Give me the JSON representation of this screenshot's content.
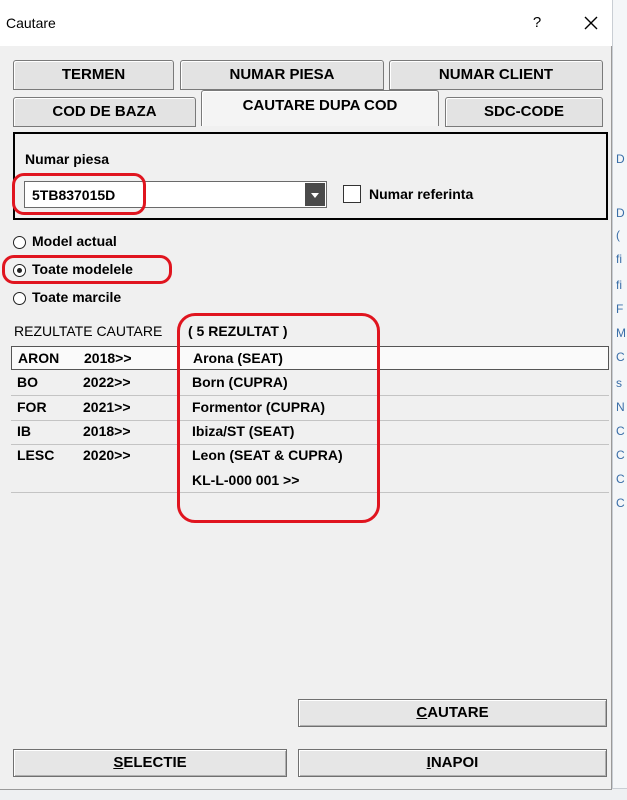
{
  "window": {
    "title": "Cautare",
    "help_label": "?"
  },
  "tabs": {
    "row1": [
      "TERMEN",
      "NUMAR PIESA",
      "NUMAR CLIENT"
    ],
    "row2": [
      "COD DE BAZA",
      "CAUTARE DUPA COD",
      "SDC-CODE"
    ],
    "active": "CAUTARE DUPA COD"
  },
  "search": {
    "label": "Numar piesa",
    "value": "5TB837015D",
    "reference_checkbox_label": "Numar referinta",
    "reference_checked": false
  },
  "scope": {
    "options": [
      "Model actual",
      "Toate modelele",
      "Toate marcile"
    ],
    "selected": "Toate modelele"
  },
  "results": {
    "header": "REZULTATE CAUTARE",
    "count_label": "( 5  REZULTAT )",
    "rows": [
      {
        "code": "ARON",
        "year": "2018>>",
        "name": "Arona (SEAT)"
      },
      {
        "code": "BO",
        "year": "2022>>",
        "name": "Born (CUPRA)"
      },
      {
        "code": "FOR",
        "year": "2021>>",
        "name": "Formentor (CUPRA)"
      },
      {
        "code": "IB",
        "year": "2018>>",
        "name": "Ibiza/ST (SEAT)"
      },
      {
        "code": "LESC",
        "year": "2020>>",
        "name": "Leon (SEAT & CUPRA)"
      }
    ],
    "extra_line": "KL-L-000 001 >>"
  },
  "buttons": {
    "search": {
      "first": "C",
      "rest": "AUTARE"
    },
    "select": {
      "first": "S",
      "rest": "ELECTIE"
    },
    "back": {
      "first": "I",
      "rest": "NAPOI"
    }
  },
  "background_letters": [
    "D",
    "D",
    "(",
    "fi",
    "fi",
    "F",
    "M",
    "C",
    "s",
    "N",
    "C",
    "C",
    "C",
    "C"
  ],
  "colors": {
    "highlight": "#e0151f",
    "dialog_bg": "#f0f0f0"
  }
}
